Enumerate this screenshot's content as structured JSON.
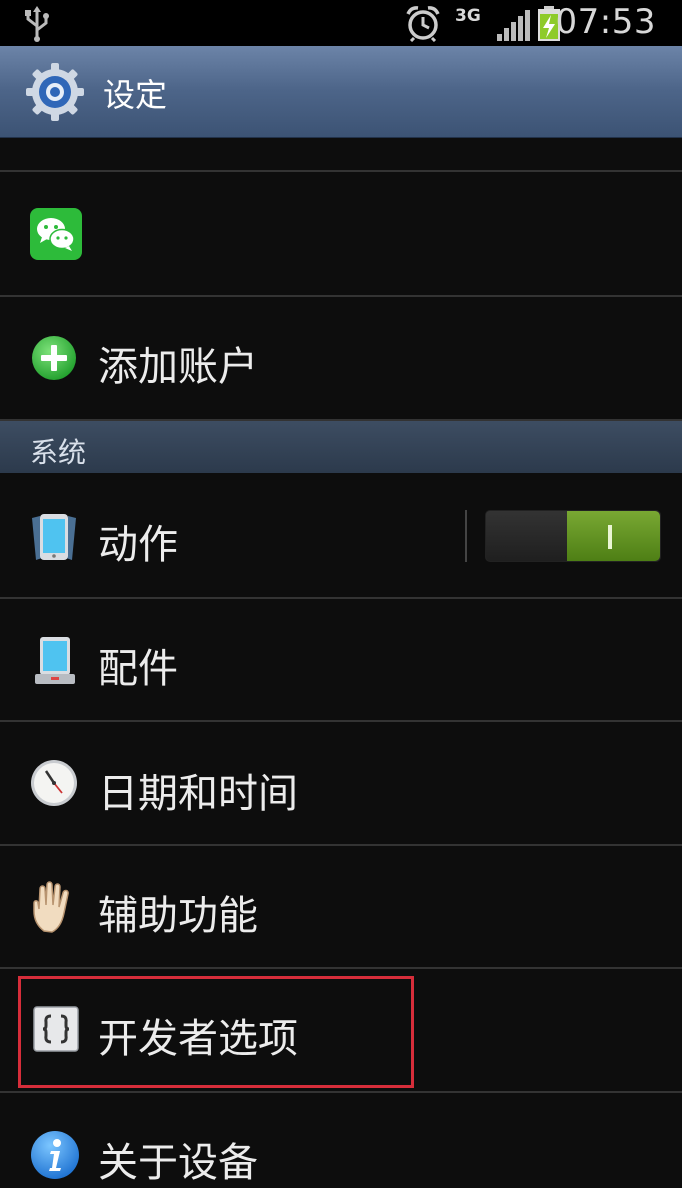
{
  "status_bar": {
    "time": "07:53",
    "network": "3G",
    "icons": [
      "usb-icon",
      "alarm-icon",
      "signal-icon",
      "battery-charging-icon"
    ]
  },
  "title_bar": {
    "title": "设定",
    "icon": "gear-icon"
  },
  "accounts": [
    {
      "label": "",
      "icon": "wechat-icon"
    },
    {
      "label": "添加账户",
      "icon": "add-circle-icon"
    }
  ],
  "section": {
    "label": "系统"
  },
  "system_items": [
    {
      "label": "动作",
      "icon": "motion-phone-icon",
      "toggle": true,
      "toggle_on": true
    },
    {
      "label": "配件",
      "icon": "accessory-icon"
    },
    {
      "label": "日期和时间",
      "icon": "clock-icon"
    },
    {
      "label": "辅助功能",
      "icon": "hand-icon"
    },
    {
      "label": "开发者选项",
      "icon": "braces-icon",
      "highlighted": true
    },
    {
      "label": "关于设备",
      "icon": "info-icon"
    }
  ],
  "colors": {
    "background": "#0d0d0d",
    "title_bar": "#4d6589",
    "section_header": "#344357",
    "toggle_on": "#6a9a24",
    "highlight_border": "#d62d3a"
  }
}
